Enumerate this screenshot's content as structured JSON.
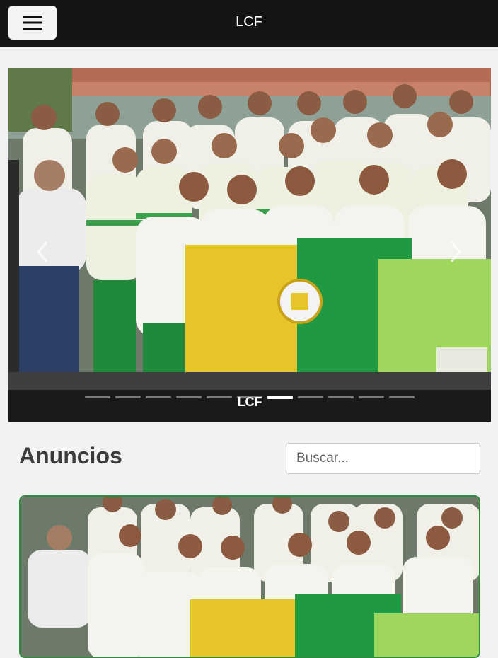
{
  "header": {
    "brand": "LCF",
    "menu_icon": "hamburger-menu-icon"
  },
  "carousel": {
    "caption": "LCF",
    "slide_count": 11,
    "active_index": 6,
    "prev_icon": "chevron-left-icon",
    "next_icon": "chevron-right-icon"
  },
  "announcements": {
    "title": "Anuncios",
    "search_placeholder": "Buscar..."
  },
  "colors": {
    "topbar": "#141414",
    "card_border": "#2e8b3c",
    "flag_yellow": "#e6c52a",
    "flag_green": "#1f9a43"
  }
}
